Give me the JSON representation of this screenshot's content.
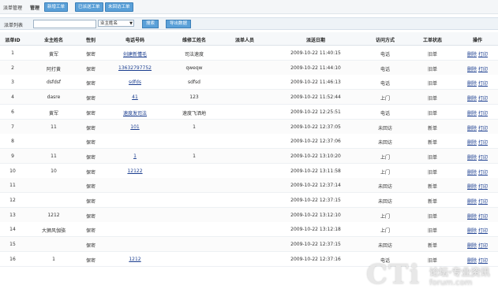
{
  "topbar": {
    "title": "派单管理",
    "section": "管理",
    "buttons": [
      "新增工单",
      "已派送工单",
      "未回访工单"
    ]
  },
  "search": {
    "label": "派单列表",
    "select_value": "业主姓名",
    "search_button": "搜索",
    "export_button": "导出数据"
  },
  "table": {
    "headers": [
      "派单ID",
      "业主姓名",
      "性别",
      "电话号码",
      "维修工姓名",
      "派单人员",
      "派送日期",
      "访问方式",
      "工单状态",
      "操作"
    ],
    "actions": {
      "delete": "删除",
      "print": "打印"
    },
    "rows": [
      {
        "id": "1",
        "owner": "黄军",
        "gender": "保密",
        "phone": "创建新懂毛",
        "worker": "司法速度",
        "date": "2009-10-22 11:40:15",
        "visit": "电话",
        "status": "旧单"
      },
      {
        "id": "2",
        "owner": "阿打黄",
        "gender": "保密",
        "phone": "13632797752",
        "worker": "qweqw",
        "date": "2009-10-22 11:44:10",
        "visit": "电话",
        "status": "旧单"
      },
      {
        "id": "3",
        "owner": "dsfdsf",
        "gender": "保密",
        "phone": "sdfds",
        "worker": "sdfsd",
        "date": "2009-10-22 11:46:13",
        "visit": "电话",
        "status": "旧单"
      },
      {
        "id": "4",
        "owner": "dasre",
        "gender": "保密",
        "phone": "41",
        "worker": "123",
        "date": "2009-10-22 11:52:44",
        "visit": "上门",
        "status": "旧单"
      },
      {
        "id": "6",
        "owner": "黄军",
        "gender": "保密",
        "phone": "速度发司法",
        "worker": "速度飞洒地",
        "date": "2009-10-22 12:25:51",
        "visit": "电话",
        "status": "旧单"
      },
      {
        "id": "7",
        "owner": "11",
        "gender": "保密",
        "phone": "101",
        "worker": "1",
        "date": "2009-10-22 12:37:05",
        "visit": "未回访",
        "status": "新单"
      },
      {
        "id": "8",
        "owner": "",
        "gender": "保密",
        "phone": "",
        "worker": "",
        "date": "2009-10-22 12:37:06",
        "visit": "未回访",
        "status": "新单"
      },
      {
        "id": "9",
        "owner": "11",
        "gender": "保密",
        "phone": "1",
        "worker": "1",
        "date": "2009-10-22 13:10:20",
        "visit": "上门",
        "status": "旧单"
      },
      {
        "id": "10",
        "owner": "10",
        "gender": "保密",
        "phone": "12122",
        "worker": "",
        "date": "2009-10-22 13:11:58",
        "visit": "上门",
        "status": "旧单"
      },
      {
        "id": "11",
        "owner": "",
        "gender": "保密",
        "phone": "",
        "worker": "",
        "date": "2009-10-22 12:37:14",
        "visit": "未回访",
        "status": "新单"
      },
      {
        "id": "12",
        "owner": "",
        "gender": "保密",
        "phone": "",
        "worker": "",
        "date": "2009-10-22 12:37:15",
        "visit": "未回访",
        "status": "新单"
      },
      {
        "id": "13",
        "owner": "1212",
        "gender": "保密",
        "phone": "",
        "worker": "",
        "date": "2009-10-22 13:12:10",
        "visit": "上门",
        "status": "旧单"
      },
      {
        "id": "14",
        "owner": "大狮风伽骆",
        "gender": "保密",
        "phone": "",
        "worker": "",
        "date": "2009-10-22 13:12:18",
        "visit": "上门",
        "status": "旧单"
      },
      {
        "id": "15",
        "owner": "",
        "gender": "保密",
        "phone": "",
        "worker": "",
        "date": "2009-10-22 12:37:15",
        "visit": "未回访",
        "status": "新单"
      },
      {
        "id": "16",
        "owner": "1",
        "gender": "保密",
        "phone": "1212",
        "worker": "",
        "date": "2009-10-22 12:37:16",
        "visit": "电话",
        "status": "旧单"
      }
    ]
  },
  "watermark": {
    "brand": "CTi",
    "tagline": "论坛·专业资讯",
    "url": "forum.com"
  },
  "colors": {
    "button": "#5aa0d8",
    "link": "#1a3d8f"
  }
}
